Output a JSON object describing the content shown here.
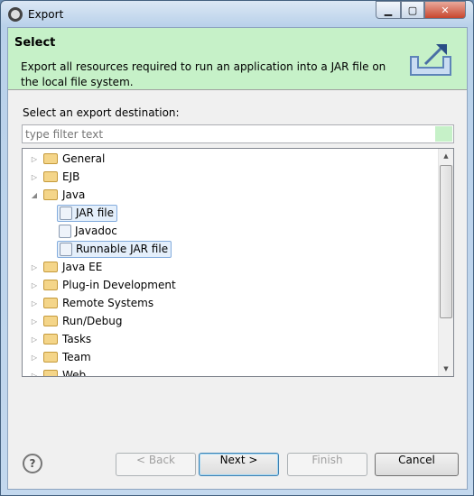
{
  "window": {
    "title": "Export"
  },
  "header": {
    "title": "Select",
    "description": "Export all resources required to run an application into a JAR file on the local file system."
  },
  "destination_label": "Select an export destination:",
  "filter": {
    "placeholder": "type filter text",
    "value": ""
  },
  "tree": [
    {
      "label": "General",
      "expanded": false,
      "level": 0
    },
    {
      "label": "EJB",
      "expanded": false,
      "level": 0
    },
    {
      "label": "Java",
      "expanded": true,
      "level": 0
    },
    {
      "label": "JAR file",
      "level": 1,
      "icon": "jar-icon",
      "selected": true
    },
    {
      "label": "Javadoc",
      "level": 1,
      "icon": "javadoc-icon"
    },
    {
      "label": "Runnable JAR file",
      "level": 1,
      "icon": "runnable-jar-icon",
      "selected": true
    },
    {
      "label": "Java EE",
      "expanded": false,
      "level": 0
    },
    {
      "label": "Plug-in Development",
      "expanded": false,
      "level": 0
    },
    {
      "label": "Remote Systems",
      "expanded": false,
      "level": 0
    },
    {
      "label": "Run/Debug",
      "expanded": false,
      "level": 0
    },
    {
      "label": "Tasks",
      "expanded": false,
      "level": 0
    },
    {
      "label": "Team",
      "expanded": false,
      "level": 0
    },
    {
      "label": "Web",
      "expanded": false,
      "level": 0
    }
  ],
  "buttons": {
    "back": "< Back",
    "next": "Next >",
    "finish": "Finish",
    "cancel": "Cancel",
    "help": "?"
  }
}
